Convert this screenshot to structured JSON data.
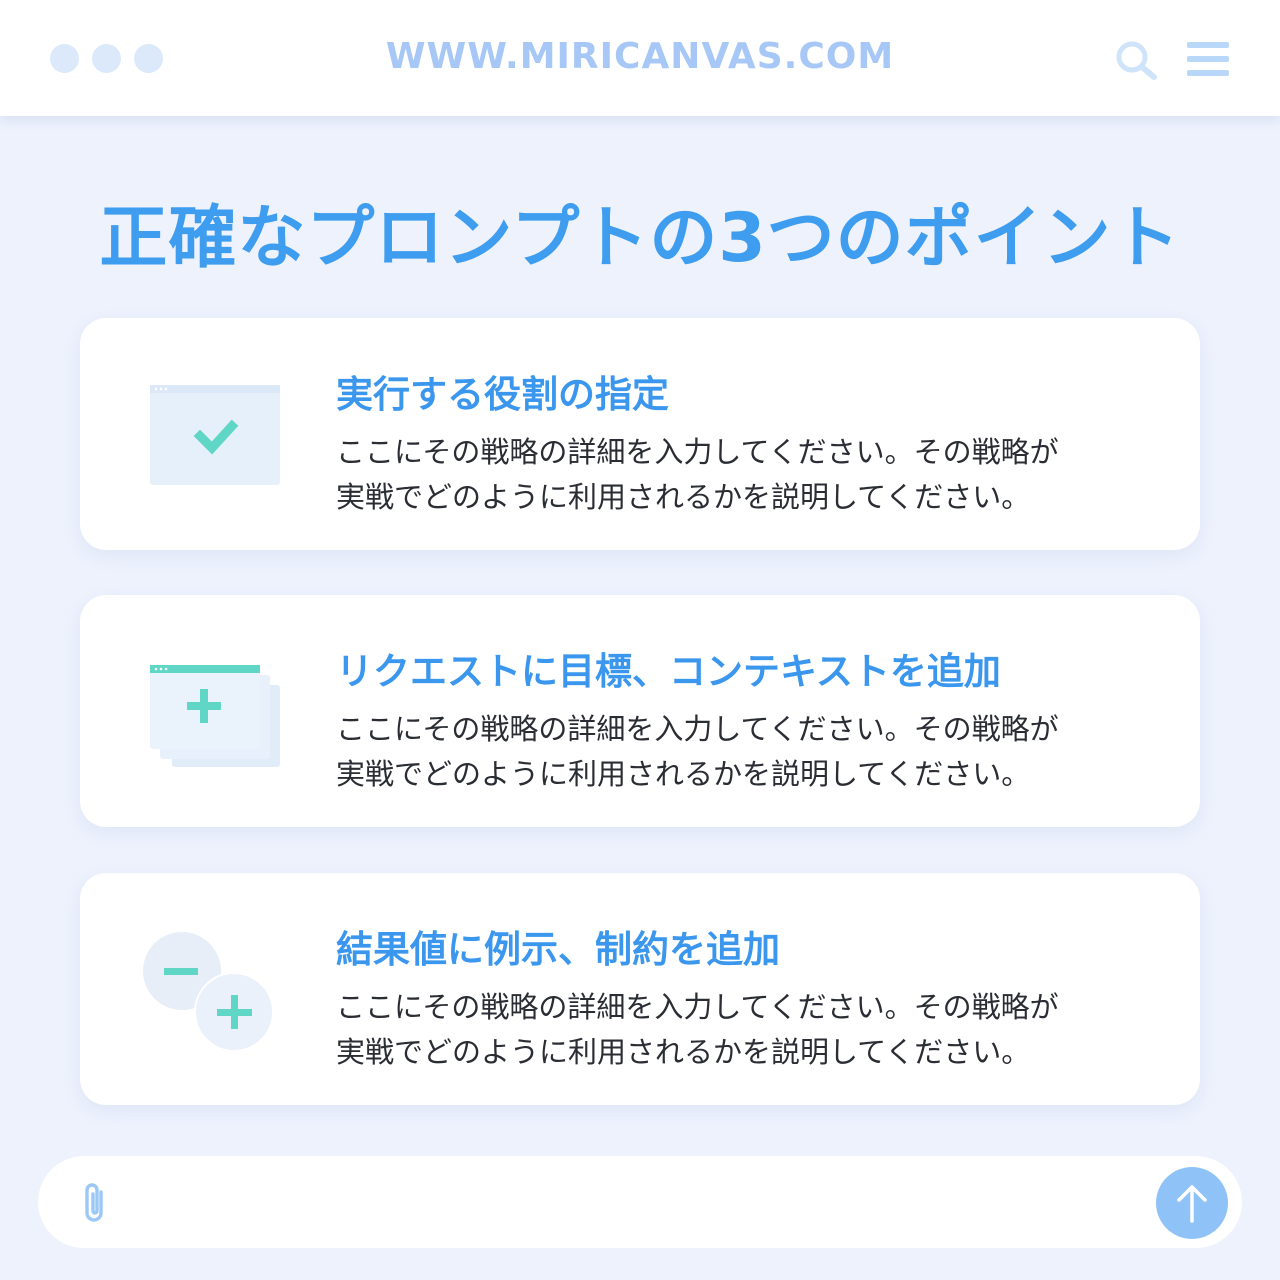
{
  "browser": {
    "url": "WWW.MIRICANVAS.COM",
    "icons": [
      "window-dot-icon",
      "search-icon",
      "menu-icon"
    ]
  },
  "page": {
    "title": "正確なプロンプトの3つのポイント"
  },
  "cards": [
    {
      "icon": "window-check-icon",
      "title": "実行する役割の指定",
      "desc_line1": "ここにその戦略の詳細を入力してください。その戦略が",
      "desc_line2": "実戦でどのように利用されるかを説明してください。"
    },
    {
      "icon": "stacked-windows-plus-icon",
      "title": "リクエストに目標、コンテキストを追加",
      "desc_line1": "ここにその戦略の詳細を入力してください。その戦略が",
      "desc_line2": "実戦でどのように利用されるかを説明してください。"
    },
    {
      "icon": "minus-plus-circles-icon",
      "title": "結果値に例示、制約を追加",
      "desc_line1": "ここにその戦略の詳細を入力してください。その戦略が",
      "desc_line2": "実戦でどのように利用されるかを説明してください。"
    }
  ],
  "chat": {
    "attach_icon": "paperclip-icon",
    "send_icon": "arrow-up-icon"
  },
  "colors": {
    "accent": "#3f9df0",
    "icon_green": "#5fd6c6",
    "background": "#eef2fd"
  }
}
